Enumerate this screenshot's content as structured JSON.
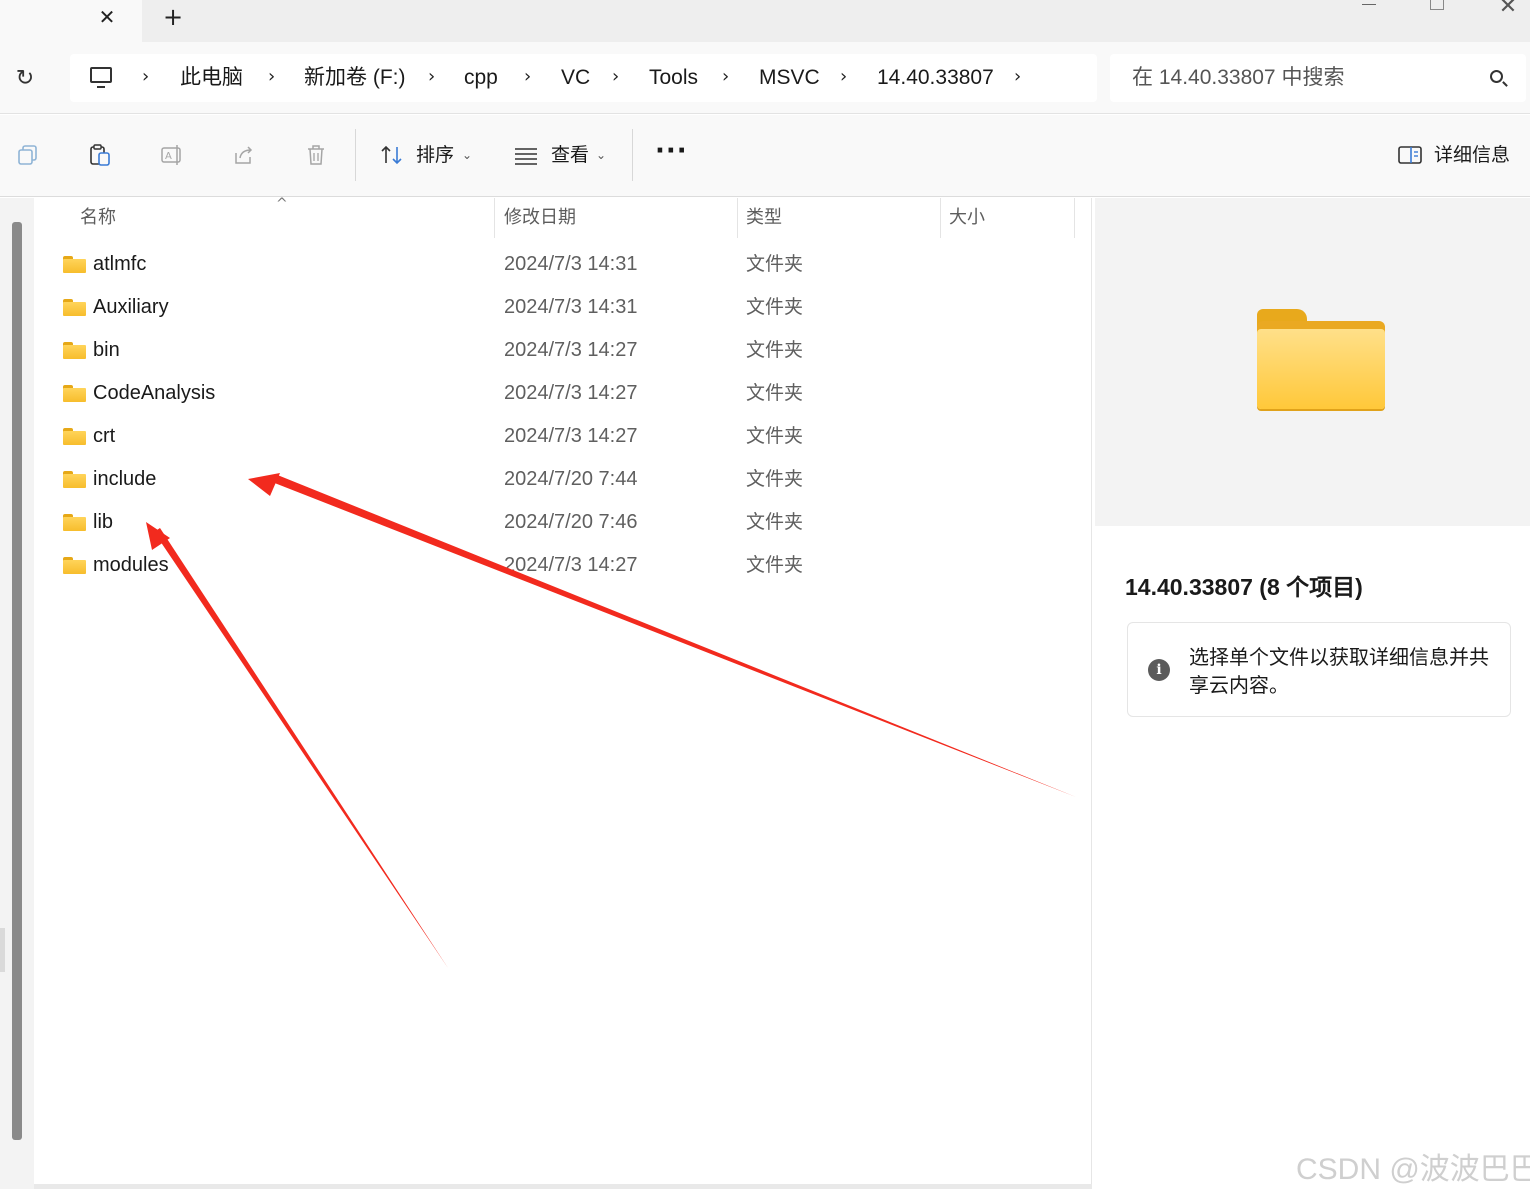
{
  "window": {
    "tab_close_glyph": "✕",
    "new_tab_glyph": "+",
    "close_glyph": "✕"
  },
  "address": {
    "refresh_glyph": "↻",
    "chevron_glyph": "›",
    "breadcrumbs": [
      "此电脑",
      "新加卷 (F:)",
      "cpp",
      "VC",
      "Tools",
      "MSVC",
      "14.40.33807"
    ],
    "search_placeholder": "在 14.40.33807 中搜索"
  },
  "toolbar": {
    "sort_label": "排序",
    "view_label": "查看",
    "more_glyph": "···",
    "details_label": "详细信息",
    "caret_glyph": "⌄"
  },
  "columns": {
    "name": "名称",
    "date": "修改日期",
    "type": "类型",
    "size": "大小",
    "sort_glyph": "^"
  },
  "files": [
    {
      "name": "atlmfc",
      "date": "2024/7/3 14:31",
      "type": "文件夹"
    },
    {
      "name": "Auxiliary",
      "date": "2024/7/3 14:31",
      "type": "文件夹"
    },
    {
      "name": "bin",
      "date": "2024/7/3 14:27",
      "type": "文件夹"
    },
    {
      "name": "CodeAnalysis",
      "date": "2024/7/3 14:27",
      "type": "文件夹"
    },
    {
      "name": "crt",
      "date": "2024/7/3 14:27",
      "type": "文件夹"
    },
    {
      "name": "include",
      "date": "2024/7/20 7:44",
      "type": "文件夹"
    },
    {
      "name": "lib",
      "date": "2024/7/20 7:46",
      "type": "文件夹"
    },
    {
      "name": "modules",
      "date": "2024/7/3 14:27",
      "type": "文件夹"
    }
  ],
  "details_pane": {
    "title": "14.40.33807 (8 个项目)",
    "info_glyph": "i",
    "info_text": "选择单个文件以获取详细信息并共享云内容。"
  },
  "watermark": "CSDN @波波巴巴",
  "colors": {
    "annotation_arrow": "#f22a1e",
    "folder_yellow": "#ffc83a"
  }
}
